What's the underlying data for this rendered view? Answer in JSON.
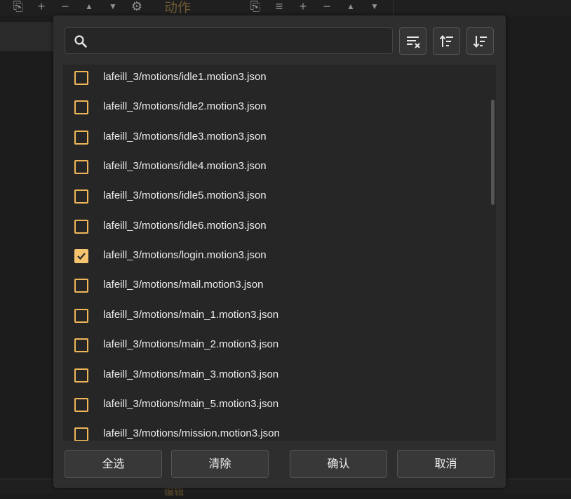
{
  "background": {
    "panel_title": "动作",
    "bottom_panel_title": "编辑"
  },
  "dialog": {
    "search": {
      "value": "",
      "placeholder": ""
    },
    "toolbar": {
      "clear_filter": "clear-sort-icon",
      "sort_ascending": "sort-ascending-icon",
      "sort_descending": "sort-descending-icon"
    },
    "items": [
      {
        "label": "lafeill_3/motions/idle1.motion3.json",
        "checked": false
      },
      {
        "label": "lafeill_3/motions/idle2.motion3.json",
        "checked": false
      },
      {
        "label": "lafeill_3/motions/idle3.motion3.json",
        "checked": false
      },
      {
        "label": "lafeill_3/motions/idle4.motion3.json",
        "checked": false
      },
      {
        "label": "lafeill_3/motions/idle5.motion3.json",
        "checked": false
      },
      {
        "label": "lafeill_3/motions/idle6.motion3.json",
        "checked": false
      },
      {
        "label": "lafeill_3/motions/login.motion3.json",
        "checked": true
      },
      {
        "label": "lafeill_3/motions/mail.motion3.json",
        "checked": false
      },
      {
        "label": "lafeill_3/motions/main_1.motion3.json",
        "checked": false
      },
      {
        "label": "lafeill_3/motions/main_2.motion3.json",
        "checked": false
      },
      {
        "label": "lafeill_3/motions/main_3.motion3.json",
        "checked": false
      },
      {
        "label": "lafeill_3/motions/main_5.motion3.json",
        "checked": false
      },
      {
        "label": "lafeill_3/motions/mission.motion3.json",
        "checked": false
      }
    ],
    "buttons": {
      "select_all": "全选",
      "clear": "清除",
      "confirm": "确认",
      "cancel": "取消"
    },
    "colors": {
      "accent": "#f6c46f",
      "checkbox_border": "#f0b65a"
    }
  }
}
